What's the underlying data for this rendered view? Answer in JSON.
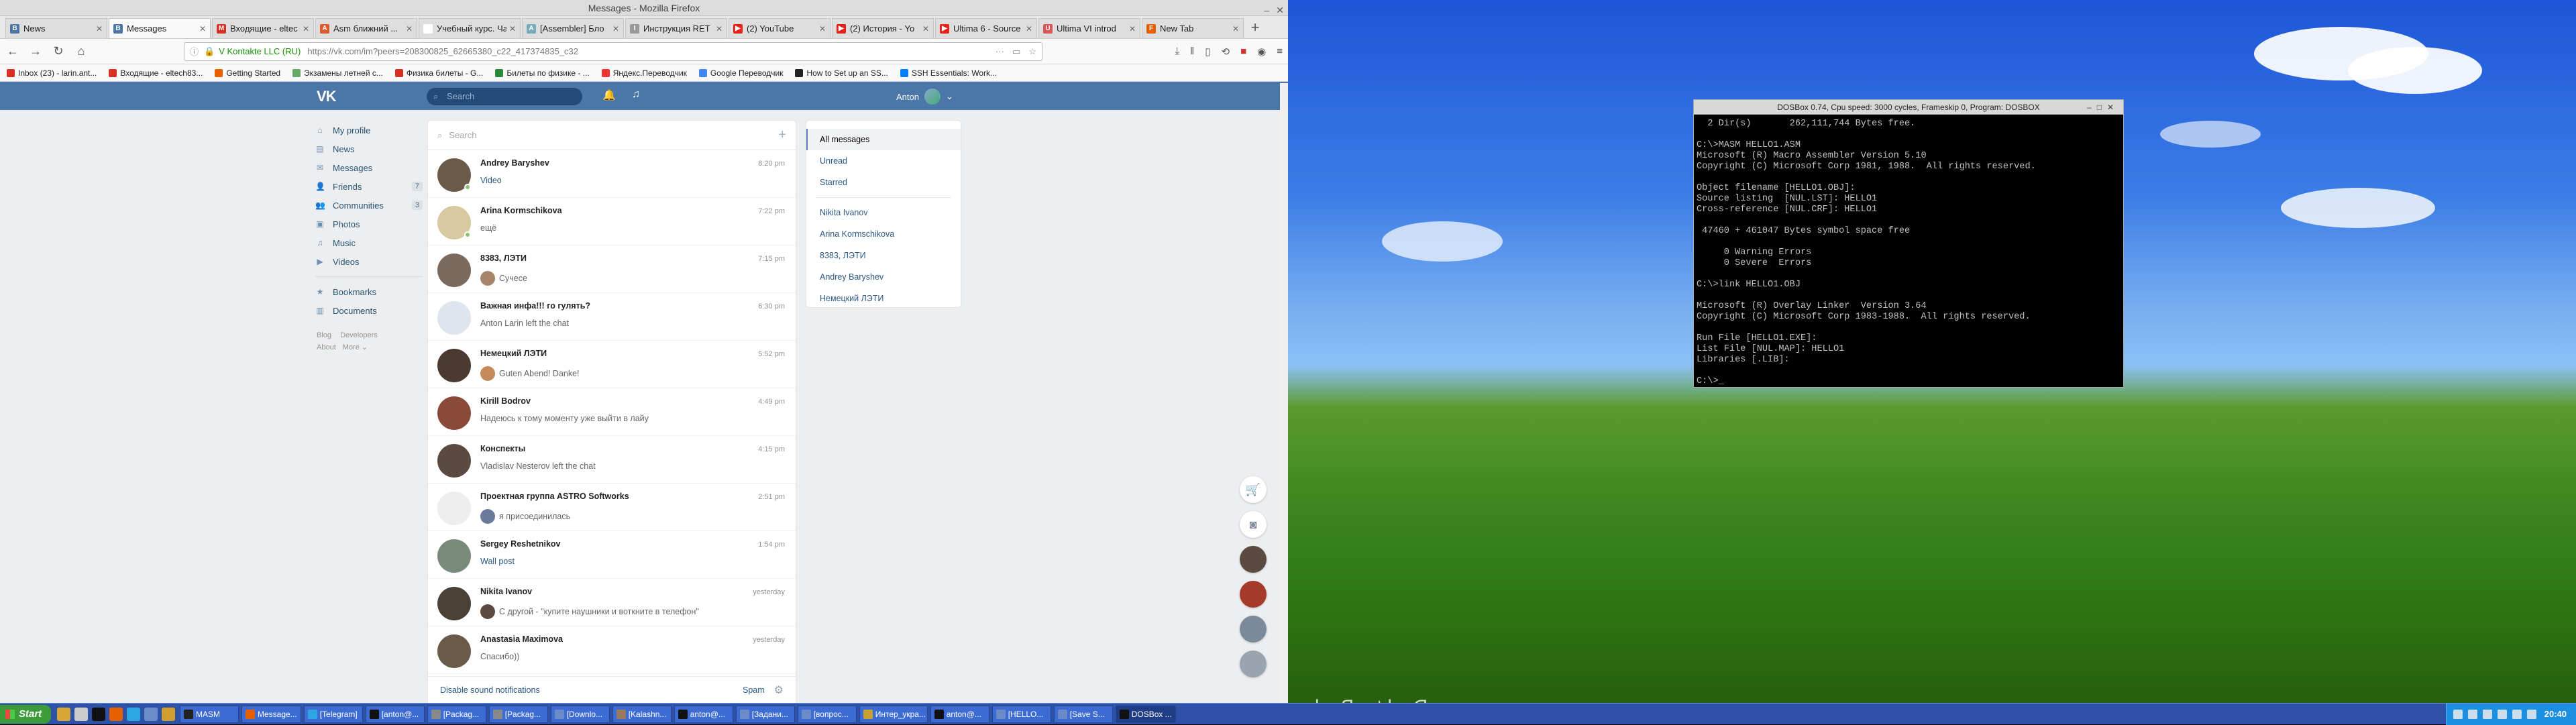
{
  "browser": {
    "title": "Messages - Mozilla Firefox",
    "tabs": [
      {
        "label": "News",
        "color": "#4a76a8",
        "glyph": "B"
      },
      {
        "label": "Messages",
        "color": "#4a76a8",
        "glyph": "B",
        "active": true
      },
      {
        "label": "Входящие - eltec",
        "color": "#d93025",
        "glyph": "M"
      },
      {
        "label": "Asm ближний ...",
        "color": "#e05a2b",
        "glyph": "A"
      },
      {
        "label": "Учебный курс. Часть",
        "color": "#ffffff",
        "glyph": ""
      },
      {
        "label": "[Assembler] Бло",
        "color": "#7ab",
        "glyph": "A"
      },
      {
        "label": "Инструкция RET",
        "color": "#999",
        "glyph": "I"
      },
      {
        "label": "(2) YouTube",
        "color": "#e62117",
        "glyph": "▶"
      },
      {
        "label": "(2) История - Yo",
        "color": "#e62117",
        "glyph": "▶"
      },
      {
        "label": "Ultima 6 - Source",
        "color": "#e62117",
        "glyph": "▶"
      },
      {
        "label": "Ultima VI introd",
        "color": "#d55",
        "glyph": "U"
      },
      {
        "label": "New Tab",
        "color": "#e66000",
        "glyph": "F"
      }
    ],
    "site_identity": "V Kontakte LLC (RU)",
    "url": "https://vk.com/im?peers=208300825_62665380_c22_417374835_c32",
    "bookmarks": [
      {
        "label": "Inbox (23) - larin.ant...",
        "color": "#d93025"
      },
      {
        "label": "Входящие - eltech83...",
        "color": "#d93025"
      },
      {
        "label": "Getting Started",
        "color": "#e66000"
      },
      {
        "label": "Экзамены летней с...",
        "color": "#6a6"
      },
      {
        "label": "Физика билеты - G...",
        "color": "#d93025"
      },
      {
        "label": "Билеты по физике - ...",
        "color": "#2a8a3a"
      },
      {
        "label": "Яндекс.Переводчик",
        "color": "#e33"
      },
      {
        "label": "Google Переводчик",
        "color": "#4285f4"
      },
      {
        "label": "How to Set up an SS...",
        "color": "#222"
      },
      {
        "label": "SSH Essentials: Work...",
        "color": "#0080ff"
      }
    ]
  },
  "vk": {
    "logo": "VK",
    "search_placeholder": "Search",
    "user_name": "Anton",
    "notif_icon": "bell-icon",
    "music_icon": "music-icon",
    "nav": [
      {
        "label": "My profile",
        "icon": "⌂"
      },
      {
        "label": "News",
        "icon": "▤"
      },
      {
        "label": "Messages",
        "icon": "✉"
      },
      {
        "label": "Friends",
        "icon": "👤",
        "count": "7"
      },
      {
        "label": "Communities",
        "icon": "👥",
        "count": "3"
      },
      {
        "label": "Photos",
        "icon": "▣"
      },
      {
        "label": "Music",
        "icon": "♫"
      },
      {
        "label": "Videos",
        "icon": "▶"
      },
      {
        "label": "Bookmarks",
        "icon": "★"
      },
      {
        "label": "Documents",
        "icon": "▥"
      }
    ],
    "footer": {
      "blog": "Blog",
      "developers": "Developers",
      "about": "About",
      "more": "More ⌄"
    },
    "messages_search": "Search",
    "conversations": [
      {
        "name": "Andrey Baryshev",
        "preview": "Video",
        "time": "8:20 pm",
        "link": true,
        "avatar": "#6b5a4a",
        "online": true
      },
      {
        "name": "Arina Kormschikova",
        "preview": "ещё",
        "time": "7:22 pm",
        "avatar": "#d9c9a0",
        "online": true
      },
      {
        "name": "8383, ЛЭТИ",
        "preview": "Сучесе",
        "time": "7:15 pm",
        "avatar": "#7a6a5e",
        "mini": "#a5846a"
      },
      {
        "name": "Важная инфа!!! го гулять?",
        "preview": "Anton Larin left the chat",
        "time": "6:30 pm",
        "avatar": "#dfe5ec"
      },
      {
        "name": "Немецкий ЛЭТИ",
        "preview": "Guten Abend! Danke!",
        "time": "5:52 pm",
        "avatar": "#4a3a30",
        "mini": "#c48a5a"
      },
      {
        "name": "Kirill Bodrov",
        "preview": "Надеюсь к тому моменту уже выйти в лайу",
        "time": "4:49 pm",
        "avatar": "#8a4a3a"
      },
      {
        "name": "Конспекты",
        "preview": "Vladislav Nesterov left the chat",
        "time": "4:15 pm",
        "avatar": "#5a4a40"
      },
      {
        "name": "Проектная группа ASTRO Softworks",
        "preview": "я присоединилась",
        "time": "2:51 pm",
        "avatar": "#eeeeee",
        "mini": "#6a7a9a"
      },
      {
        "name": "Sergey Reshetnikov",
        "preview": "Wall post",
        "time": "1:54 pm",
        "link": true,
        "avatar": "#7a8a7a"
      },
      {
        "name": "Nikita Ivanov",
        "preview": "С другой - \"купите наушники и воткните в телефон\"",
        "time": "yesterday",
        "avatar": "#4a4035",
        "mini": "#5a4a40"
      },
      {
        "name": "Anastasia Maximova",
        "preview": "Спасибо))",
        "time": "yesterday",
        "avatar": "#6a5a4a"
      }
    ],
    "disable_sound": "Disable sound notifications",
    "spam": "Spam",
    "filters": {
      "all": "All messages",
      "unread": "Unread",
      "starred": "Starred",
      "peers": [
        "Nikita Ivanov",
        "Arina Kormschikova",
        "8383, ЛЭТИ",
        "Andrey Baryshev",
        "Немецкий ЛЭТИ"
      ]
    },
    "chatbar": [
      "cart-icon",
      "camera-icon",
      "avatar",
      "avatar",
      "avatar",
      "avatar"
    ]
  },
  "dosbox": {
    "title": "DOSBox 0.74, Cpu speed:   3000 cycles, Frameskip 0, Program:  DOSBOX",
    "screen": "  2 Dir(s)       262,111,744 Bytes free.\n\nC:\\>MASM HELLO1.ASM\nMicrosoft (R) Macro Assembler Version 5.10\nCopyright (C) Microsoft Corp 1981, 1988.  All rights reserved.\n\nObject filename [HELLO1.OBJ]:\nSource listing  [NUL.LST]: HELLO1\nCross-reference [NUL.CRF]: HELLO1\n\n 47460 + 461047 Bytes symbol space free\n\n     0 Warning Errors\n     0 Severe  Errors\n\nC:\\>link HELLO1.OBJ\n\nMicrosoft (R) Overlay Linker  Version 3.64\nCopyright (C) Microsoft Corp 1983-1988.  All rights reserved.\n\nRun File [HELLO1.EXE]:\nList File [NUL.MAP]: HELLO1\nLibraries [.LIB]:\n\nC:\\>_"
  },
  "desktop": {
    "watermark": "www.DesktopBackground.org"
  },
  "taskbar": {
    "start": "Start",
    "buttons": [
      {
        "label": "MASM",
        "color": "#222"
      },
      {
        "label": "Message...",
        "color": "#e66000"
      },
      {
        "label": "[Telegram]",
        "color": "#2ca5e0"
      },
      {
        "label": "[anton@...",
        "color": "#111"
      },
      {
        "label": "[Packag...",
        "color": "#888"
      },
      {
        "label": "[Packag...",
        "color": "#888"
      },
      {
        "label": "[Downlo...",
        "color": "#6a8ac8"
      },
      {
        "label": "[Kalashn...",
        "color": "#9a7a5a"
      },
      {
        "label": "anton@...",
        "color": "#111"
      },
      {
        "label": "[Задани...",
        "color": "#6a8ac8"
      },
      {
        "label": "[вопрос...",
        "color": "#6a8ac8"
      },
      {
        "label": "Интер_укра...",
        "color": "#c8a030"
      },
      {
        "label": "anton@...",
        "color": "#111"
      },
      {
        "label": "[HELLO...",
        "color": "#6a8ac8"
      },
      {
        "label": "[Save S...",
        "color": "#6a8ac8"
      },
      {
        "label": "DOSBox ...",
        "color": "#111",
        "active": true
      }
    ],
    "clock": "20:40"
  }
}
